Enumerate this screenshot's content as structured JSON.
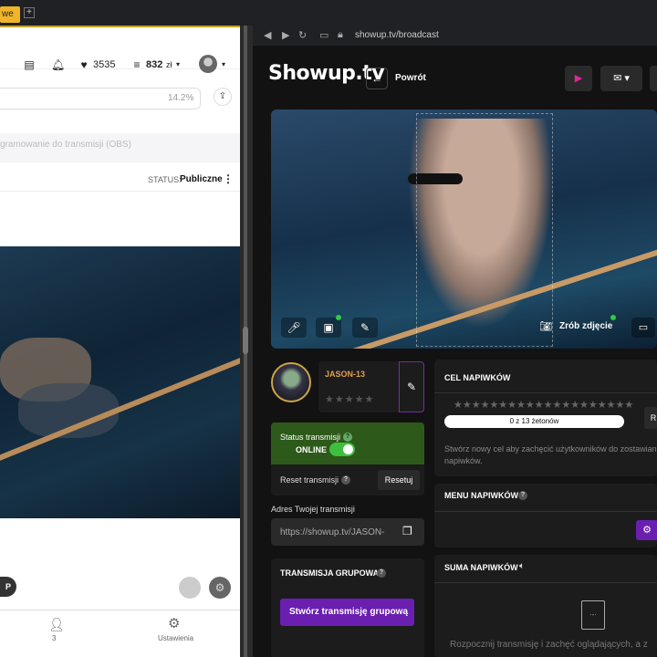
{
  "browser": {
    "tab_left_label": "we",
    "tab_plus": "+",
    "url": "showup.tv/broadcast"
  },
  "left_app": {
    "header": {
      "tokens_count": "3535",
      "coins": "832",
      "currency": "zł"
    },
    "url_percent": "14.2%",
    "obs_text": "gramowanie do transmisji (OBS)",
    "status_label": "STATUS:",
    "status_value": "Publiczne",
    "pill_button": "P",
    "bottom_nav": {
      "viewers_count": "3",
      "settings_label": "Ustawienia"
    }
  },
  "right_app": {
    "logo": "Showup.tv",
    "back_label": "Powrót",
    "snapshot_label": "Zrób zdjęcie",
    "profile": {
      "name": "JASON-13",
      "stars": "★★★★★"
    },
    "status_panel": {
      "title": "Status transmisji",
      "online_label": "ONLINE",
      "online": true
    },
    "reset_label": "Reset transmisji",
    "reset_button": "Resetuj",
    "address_label": "Adres Twojej transmisji",
    "address_value": "https://showup.tv/JASON-",
    "group_panel": {
      "title": "TRANSMISJA GRUPOWA",
      "button": "Stwórz transmisję grupową"
    },
    "tips_goal": {
      "title": "CEL NAPIWKÓW",
      "stars": "★★★★★★★★★★★★★★★★★★★★",
      "progress_text": "0 z 13 żetonów",
      "progress": 0,
      "side_button": "R",
      "description": "Stwórz nowy cel aby zachęcić użytkowników do zostawiania napiwków."
    },
    "tips_menu": {
      "title": "MENU NAPIWKÓW"
    },
    "tips_sum": {
      "title": "SUMA NAPIWKÓW",
      "empty_text": "Rozpocznij transmisję i zachęć oglądających, a z"
    }
  },
  "colors": {
    "accent_purple": "#6a1fb0",
    "online_green": "#2d5a1a",
    "name_orange": "#e0a050",
    "record_pink": "#e0249a"
  }
}
